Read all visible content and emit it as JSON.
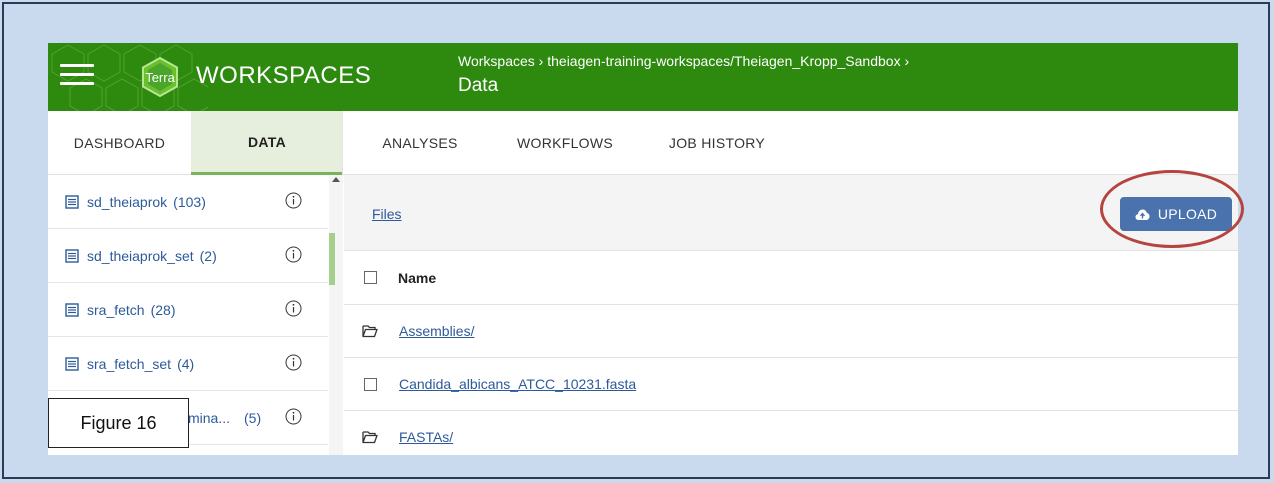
{
  "header": {
    "app_title": "WORKSPACES",
    "logo_text": "Terra",
    "breadcrumb": {
      "root": "Workspaces",
      "sep": "›",
      "workspace": "theiagen-training-workspaces/Theiagen_Kropp_Sandbox"
    },
    "page_title": "Data"
  },
  "tabs": [
    {
      "label": "DASHBOARD"
    },
    {
      "label": "DATA"
    },
    {
      "label": "ANALYSES"
    },
    {
      "label": "WORKFLOWS"
    },
    {
      "label": "JOB HISTORY"
    }
  ],
  "sidebar": {
    "items": [
      {
        "label": "sd_theiaprok",
        "count": "(103)"
      },
      {
        "label": "sd_theiaprok_set",
        "count": "(2)"
      },
      {
        "label": "sra_fetch",
        "count": "(28)"
      },
      {
        "label": "sra_fetch_set",
        "count": "(4)"
      },
      {
        "label": "mina...",
        "count": "(5)"
      }
    ]
  },
  "main": {
    "files_link": "Files",
    "upload_label": "UPLOAD",
    "column_name": "Name",
    "rows": [
      {
        "name": "Assemblies/",
        "type": "folder"
      },
      {
        "name": "Candida_albicans_ATCC_10231.fasta",
        "type": "file"
      },
      {
        "name": "FASTAs/",
        "type": "folder"
      }
    ]
  },
  "annotation": {
    "figure_label": "Figure 16"
  },
  "colors": {
    "header_green": "#2d8a0f",
    "link_blue": "#2d5a9a",
    "upload_blue": "#4a73ad",
    "annotation_red": "#b5443e",
    "background_blue": "#c9d9ee"
  }
}
